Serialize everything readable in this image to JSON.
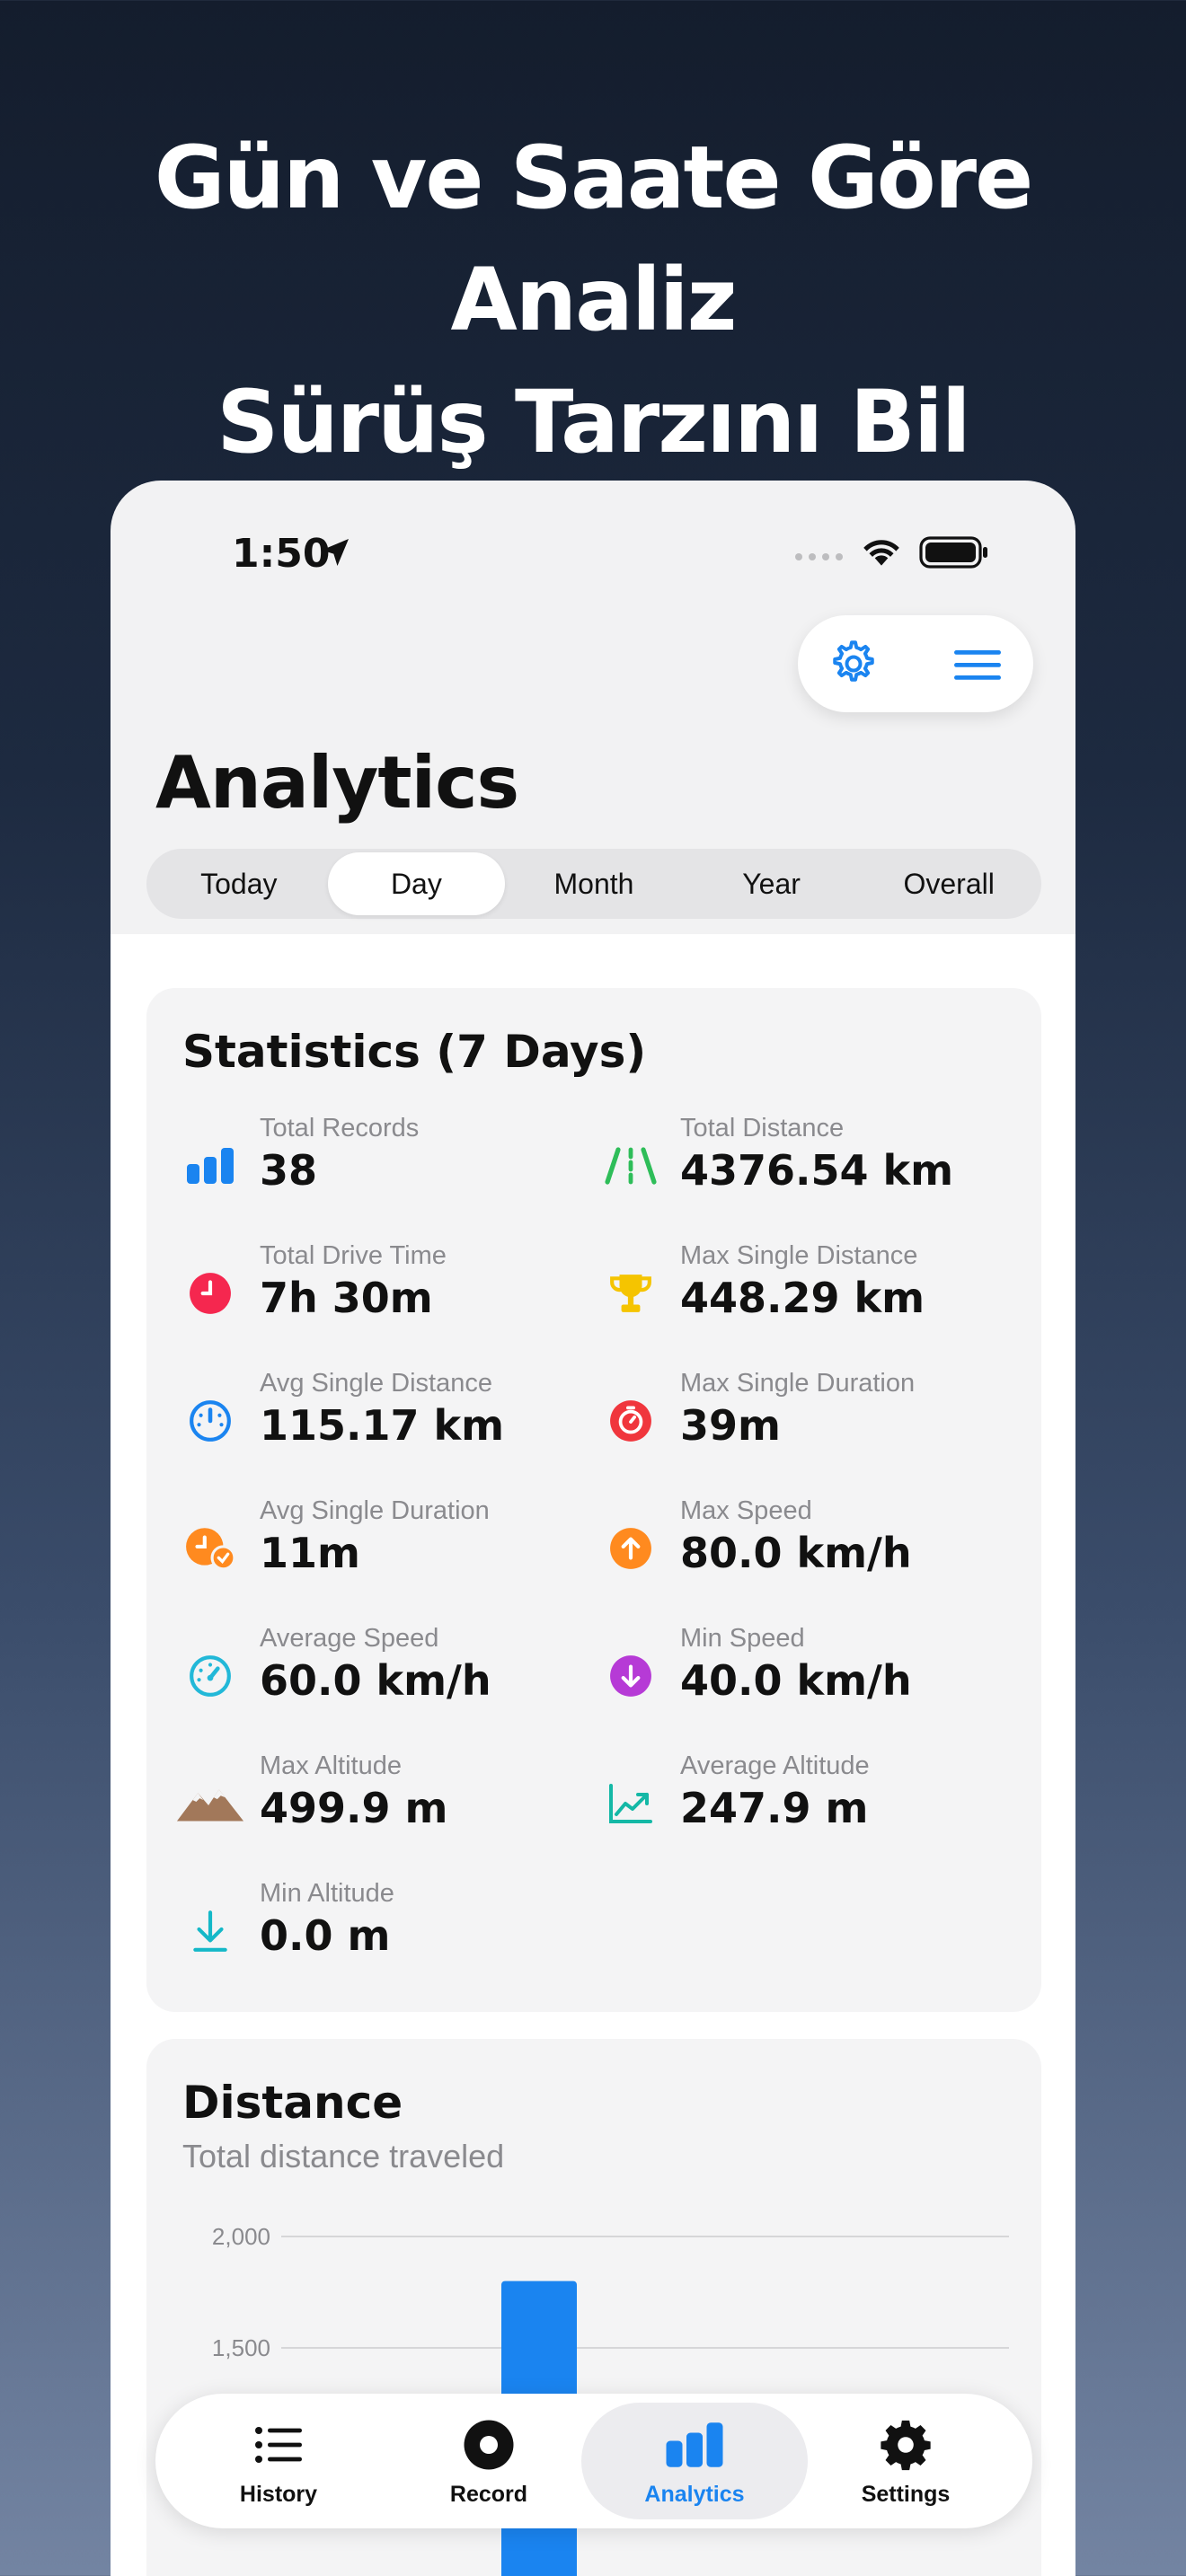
{
  "headline": {
    "line1": "Gün ve Saate Göre Analiz",
    "line2": "Sürüş Tarzını Bil"
  },
  "status_bar": {
    "time": "1:50"
  },
  "page": {
    "title": "Analytics"
  },
  "segments": [
    {
      "label": "Today"
    },
    {
      "label": "Day",
      "selected": true
    },
    {
      "label": "Month"
    },
    {
      "label": "Year"
    },
    {
      "label": "Overall"
    }
  ],
  "stats": {
    "title": "Statistics (7 Days)",
    "items": [
      {
        "label": "Total Records",
        "value": "38",
        "icon": "bar-chart-icon",
        "color": "#1a84f0"
      },
      {
        "label": "Total Distance",
        "value": "4376.54 km",
        "icon": "road-icon",
        "color": "#2ebd59"
      },
      {
        "label": "Total Drive Time",
        "value": "7h 30m",
        "icon": "clock-icon",
        "color": "#f5274f"
      },
      {
        "label": "Max Single Distance",
        "value": "448.29 km",
        "icon": "trophy-icon",
        "color": "#f5c400"
      },
      {
        "label": "Avg Single Distance",
        "value": "115.17 km",
        "icon": "gauge-icon",
        "color": "#1a84f0"
      },
      {
        "label": "Max Single Duration",
        "value": "39m",
        "icon": "timer-icon",
        "color": "#f0363d"
      },
      {
        "label": "Avg Single Duration",
        "value": "11m",
        "icon": "clock-check-icon",
        "color": "#ff8a1f"
      },
      {
        "label": "Max Speed",
        "value": "80.0 km/h",
        "icon": "arrow-up-circle-icon",
        "color": "#ff8a1f"
      },
      {
        "label": "Average Speed",
        "value": "60.0 km/h",
        "icon": "speedometer-icon",
        "color": "#22b8d8"
      },
      {
        "label": "Min Speed",
        "value": "40.0 km/h",
        "icon": "arrow-down-circle-icon",
        "color": "#b63ad6"
      },
      {
        "label": "Max Altitude",
        "value": "499.9 m",
        "icon": "mountain-icon",
        "color": "#a2785a"
      },
      {
        "label": "Average Altitude",
        "value": "247.9 m",
        "icon": "trend-chart-icon",
        "color": "#14b8a6"
      },
      {
        "label": "Min Altitude",
        "value": "0.0 m",
        "icon": "arrow-down-to-line-icon",
        "color": "#14b8c8"
      }
    ]
  },
  "distance_card": {
    "title": "Distance",
    "subtitle": "Total distance traveled"
  },
  "chart_data": {
    "type": "bar",
    "title": "Distance",
    "subtitle": "Total distance traveled",
    "y_ticks": [
      "2,000",
      "1,500"
    ],
    "ylim": [
      1000,
      2000
    ],
    "values": [
      1800
    ],
    "grid": true,
    "bar_color": "#1a84f0"
  },
  "tabbar": {
    "items": [
      {
        "label": "History",
        "icon": "list-icon"
      },
      {
        "label": "Record",
        "icon": "record-icon"
      },
      {
        "label": "Analytics",
        "icon": "bar-chart-icon",
        "active": true
      },
      {
        "label": "Settings",
        "icon": "gear-icon"
      }
    ]
  },
  "colors": {
    "accent": "#1a84f0",
    "card_bg": "#f4f4f5",
    "background_top": "#141d2d"
  }
}
